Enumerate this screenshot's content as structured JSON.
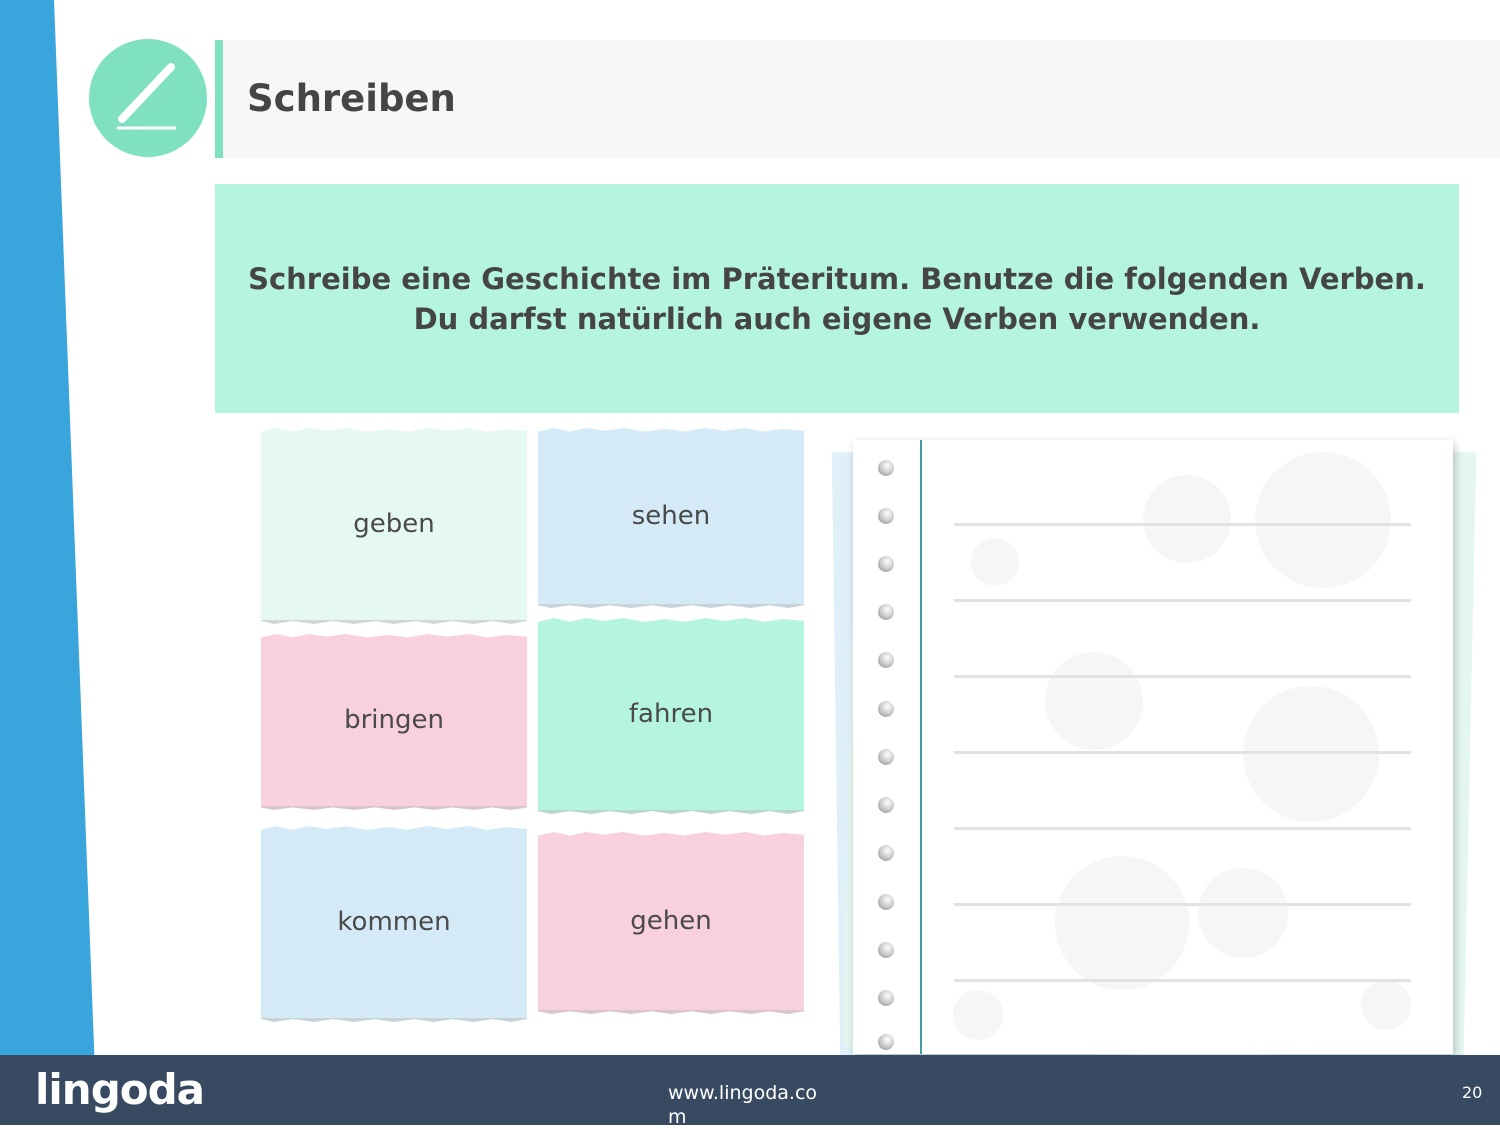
{
  "header": {
    "title": "Schreiben",
    "icon": "pencil-icon",
    "accent_color": "#7fe0c2"
  },
  "instruction": {
    "line1": "Schreibe eine Geschichte im Präteritum. Benutze die folgenden Verben.",
    "line2": "Du darfst natürlich auch eigene Verben verwenden."
  },
  "verbs": [
    "geben",
    "sehen",
    "bringen",
    "fahren",
    "kommen",
    "gehen"
  ],
  "notebook": {
    "line_count": 7,
    "ring_count": 13
  },
  "footer": {
    "logo": "lingoda",
    "url": "www.lingoda.com",
    "page_number": "20"
  },
  "colors": {
    "side_stripe": "#3aa5dc",
    "footer_bg": "#374a61",
    "mint": "#b5f5de",
    "blue": "#d4ebf7",
    "pink": "#f8d0de",
    "text": "#454545"
  }
}
